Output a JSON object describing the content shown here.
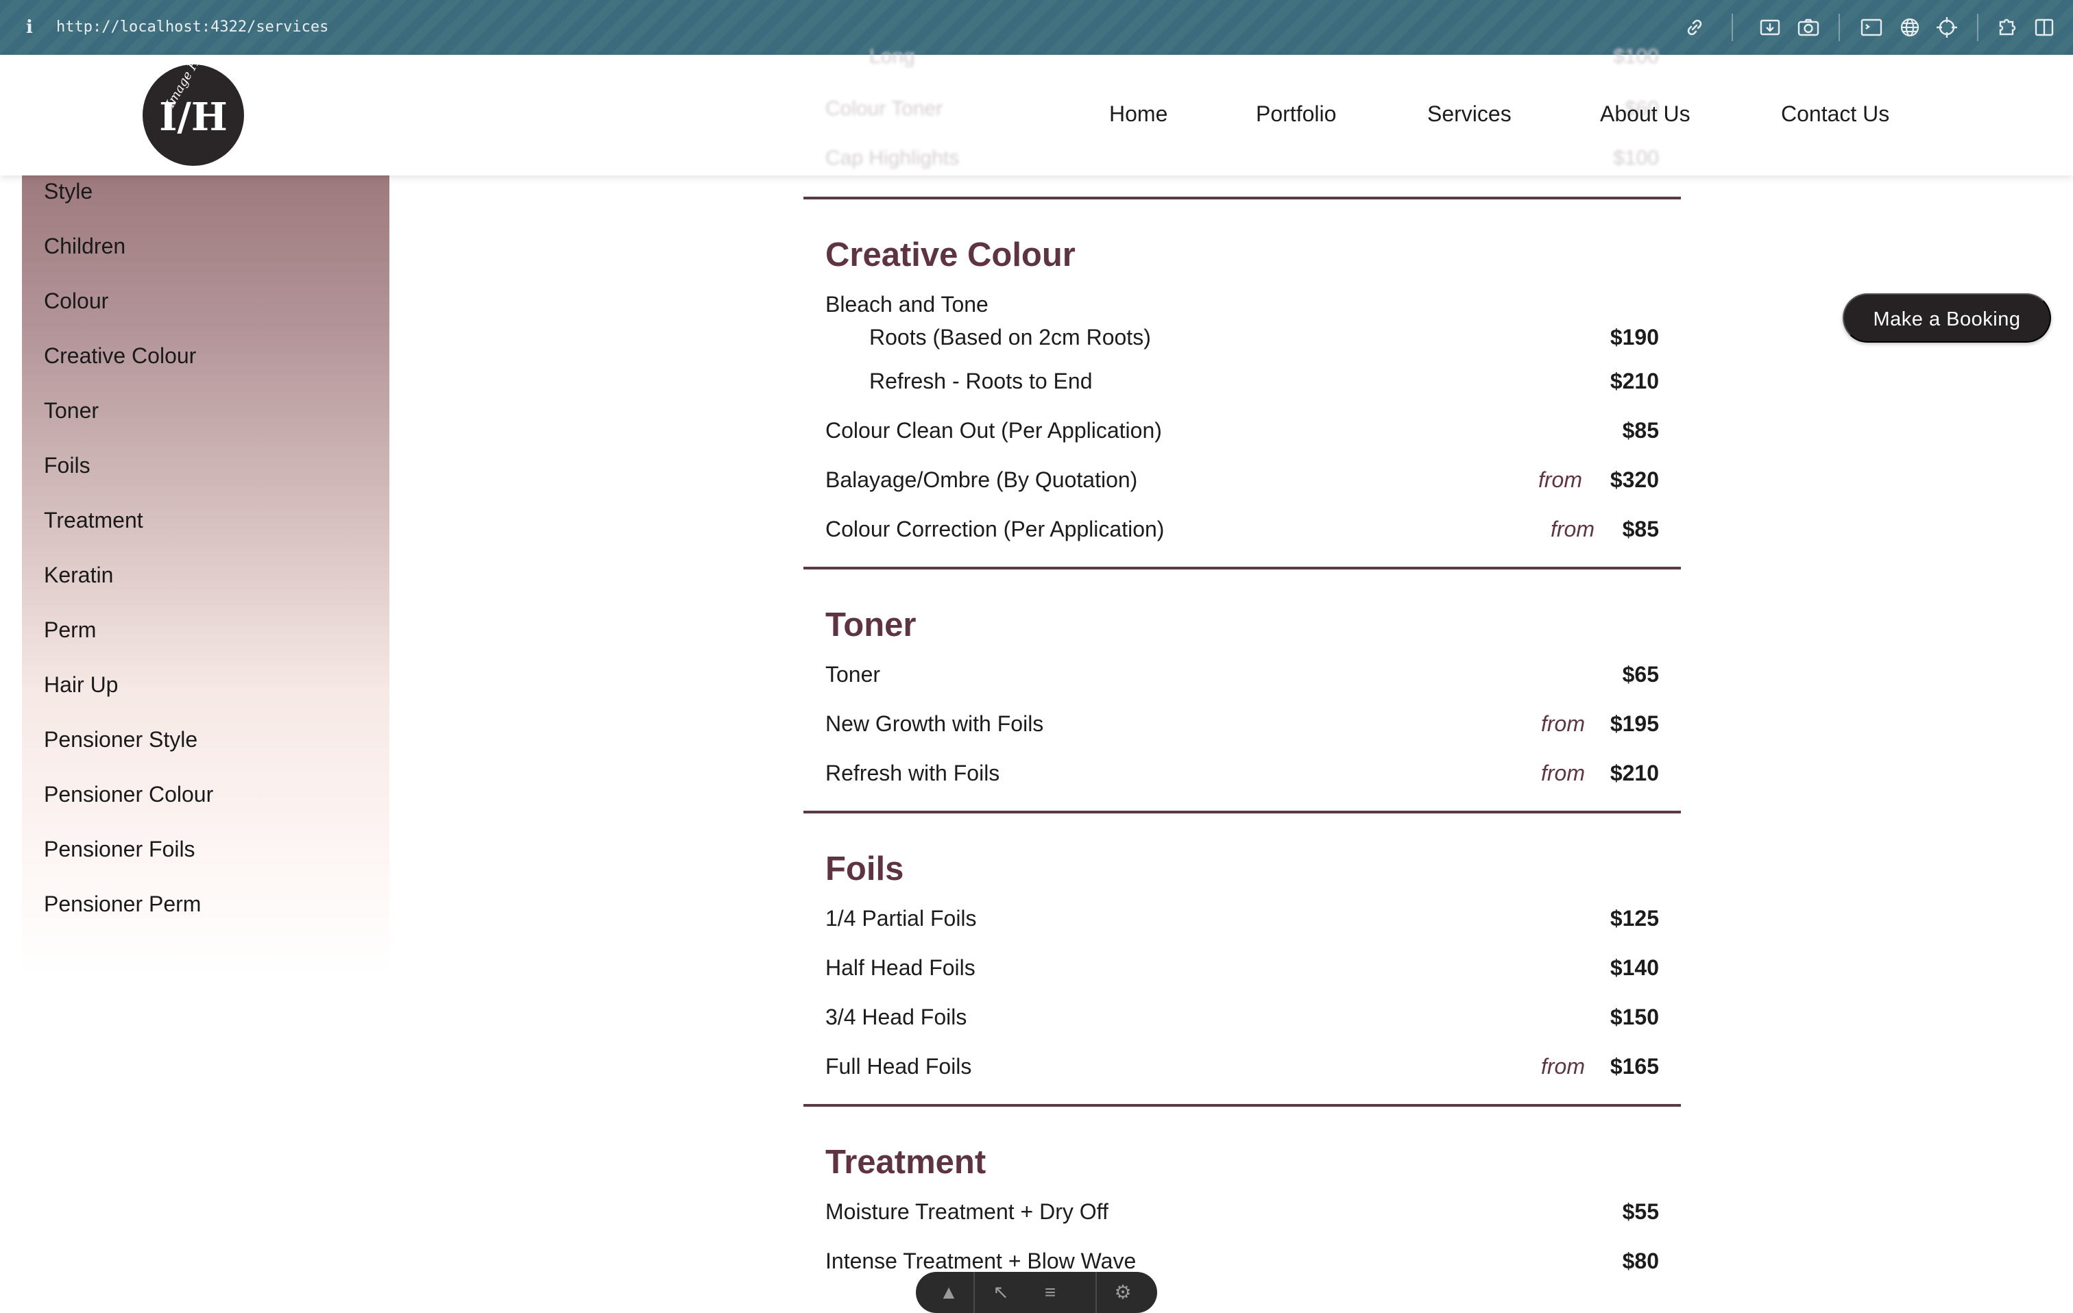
{
  "browser": {
    "url": "http://localhost:4322/services",
    "icons": [
      "link-icon",
      "save-page-icon",
      "camera-icon",
      "terminal-icon",
      "globe-icon",
      "crosshair-icon",
      "extensions-icon",
      "sidebar-icon"
    ]
  },
  "header": {
    "logo_text": "Image Hair",
    "logo_monogram": "I/H",
    "nav": [
      "Home",
      "Portfolio",
      "Services",
      "About Us",
      "Contact Us"
    ],
    "ghost_rows": [
      {
        "name": "Long",
        "price": "$100"
      },
      {
        "name": "Colour Toner",
        "price": "$60"
      },
      {
        "name": "Cap Highlights",
        "price": "$100"
      }
    ]
  },
  "sidebar": {
    "items": [
      "Style",
      "Children",
      "Colour",
      "Creative Colour",
      "Toner",
      "Foils",
      "Treatment",
      "Keratin",
      "Perm",
      "Hair Up",
      "Pensioner Style",
      "Pensioner Colour",
      "Pensioner Foils",
      "Pensioner Perm"
    ]
  },
  "booking_button": "Make a Booking",
  "from_label": "from",
  "sections": {
    "creative_colour": {
      "title": "Creative Colour",
      "group_label": "Bleach and Tone",
      "sub_items": [
        {
          "name": "Roots (Based on 2cm Roots)",
          "price": "$190"
        },
        {
          "name": "Refresh - Roots to End",
          "price": "$210"
        }
      ],
      "items": [
        {
          "name": "Colour Clean Out (Per Application)",
          "price": "$85",
          "from": false
        },
        {
          "name": "Balayage/Ombre (By Quotation)",
          "price": "$320",
          "from": true
        },
        {
          "name": "Colour Correction (Per Application)",
          "price": "$85",
          "from": true
        }
      ]
    },
    "toner": {
      "title": "Toner",
      "items": [
        {
          "name": "Toner",
          "price": "$65",
          "from": false
        },
        {
          "name": "New Growth with Foils",
          "price": "$195",
          "from": true
        },
        {
          "name": "Refresh with Foils",
          "price": "$210",
          "from": true
        }
      ]
    },
    "foils": {
      "title": "Foils",
      "items": [
        {
          "name": "1/4 Partial Foils",
          "price": "$125",
          "from": false
        },
        {
          "name": "Half Head Foils",
          "price": "$140",
          "from": false
        },
        {
          "name": "3/4 Head Foils",
          "price": "$150",
          "from": false
        },
        {
          "name": "Full Head Foils",
          "price": "$165",
          "from": true
        }
      ]
    },
    "treatment": {
      "title": "Treatment",
      "items": [
        {
          "name": "Moisture Treatment + Dry Off",
          "price": "$55",
          "from": false
        },
        {
          "name": "Intense Treatment + Blow Wave",
          "price": "$80",
          "from": false
        }
      ]
    }
  },
  "colors": {
    "accent": "#5e3342",
    "rule": "#5b3a45",
    "button_bg": "#262223",
    "browser_bar": "#3d6b7e"
  }
}
